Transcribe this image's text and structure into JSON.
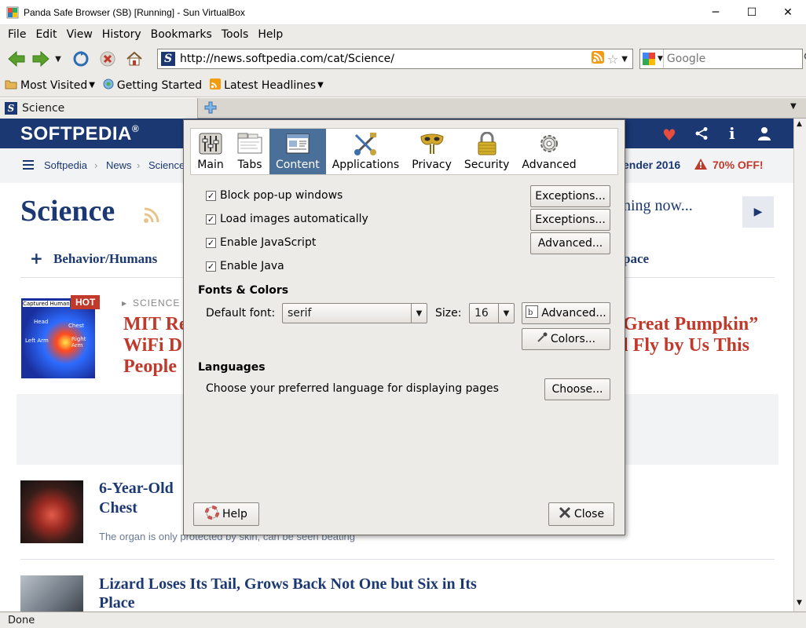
{
  "window": {
    "title": "Panda Safe Browser (SB) [Running] - Sun VirtualBox",
    "minimize": "─",
    "maximize": "☐",
    "close": "✕"
  },
  "menu": [
    "File",
    "Edit",
    "View",
    "History",
    "Bookmarks",
    "Tools",
    "Help"
  ],
  "nav": {
    "url": "http://news.softpedia.com/cat/Science/",
    "search_placeholder": "Google"
  },
  "bookmarks": [
    {
      "label": "Most Visited",
      "dropdown": true
    },
    {
      "label": "Getting Started",
      "dropdown": false
    },
    {
      "label": "Latest Headlines",
      "dropdown": true
    }
  ],
  "tabs": [
    {
      "label": "Science"
    }
  ],
  "webpage": {
    "logo": "SOFTPEDIA",
    "logo_mark": "®",
    "breadcrumbs": [
      "Softpedia",
      "News",
      "Science"
    ],
    "promo_year": "ender 2016",
    "promo_off": "70% OFF!",
    "page_title": "Science",
    "trending_text": "ning now...",
    "category": "Behavior/Humans",
    "category_right": "pace",
    "hot_badge": "HOT",
    "hot_section": "SCIENCE",
    "featured_title_lines": [
      "MIT Re",
      "WiFi D",
      "People"
    ],
    "featured_right_lines": [
      "Great Pumpkin”",
      "l Fly by Us This"
    ],
    "image_labels": [
      "Captured Human",
      "Head",
      "Chest",
      "Left Arm",
      "Right Arm"
    ],
    "article1_title_lines": [
      "6-Year-Old",
      "Chest"
    ],
    "article1_sub": "The organ is only protected by skin, can be seen beating",
    "article2_title_lines": [
      "Lizard Loses Its Tail, Grows Back Not One but Six in Its",
      "Place"
    ]
  },
  "status": "Done",
  "dialog": {
    "panes": [
      {
        "label": "Main",
        "selected": false
      },
      {
        "label": "Tabs",
        "selected": false
      },
      {
        "label": "Content",
        "selected": true
      },
      {
        "label": "Applications",
        "selected": false
      },
      {
        "label": "Privacy",
        "selected": false
      },
      {
        "label": "Security",
        "selected": false
      },
      {
        "label": "Advanced",
        "selected": false
      }
    ],
    "checks": [
      {
        "label": "Block pop-up windows",
        "checked": true
      },
      {
        "label": "Load images automatically",
        "checked": true
      },
      {
        "label": "Enable JavaScript",
        "checked": true
      },
      {
        "label": "Enable Java",
        "checked": true
      }
    ],
    "exceptions1": "Exceptions...",
    "exceptions2": "Exceptions...",
    "advanced_js": "Advanced...",
    "fonts_heading": "Fonts & Colors",
    "default_font_label": "Default font:",
    "default_font_value": "serif",
    "size_label": "Size:",
    "size_value": "16",
    "fonts_advanced": "Advanced...",
    "colors": "Colors...",
    "languages_heading": "Languages",
    "languages_text": "Choose your preferred language for displaying pages",
    "choose": "Choose...",
    "help": "Help",
    "close": "Close"
  }
}
